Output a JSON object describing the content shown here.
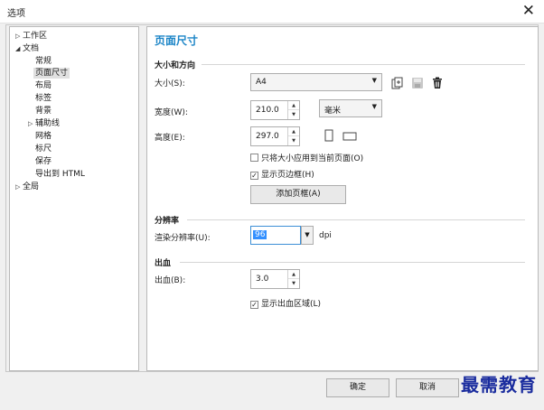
{
  "window": {
    "title": "选项"
  },
  "tree": {
    "items": [
      {
        "label": "工作区",
        "arrow": "▷"
      },
      {
        "label": "文档",
        "arrow": "◢"
      },
      {
        "label": "常规"
      },
      {
        "label": "页面尺寸"
      },
      {
        "label": "布局"
      },
      {
        "label": "标签"
      },
      {
        "label": "背景"
      },
      {
        "label": "辅助线",
        "arrow": "▷"
      },
      {
        "label": "网格"
      },
      {
        "label": "标尺"
      },
      {
        "label": "保存"
      },
      {
        "label": "导出到 HTML"
      },
      {
        "label": "全局",
        "arrow": "▷"
      }
    ]
  },
  "panel": {
    "title": "页面尺寸",
    "size_section": "大小和方向",
    "size_label": "大小(S):",
    "size_value": "A4",
    "width_label": "宽度(W):",
    "width_value": "210.0",
    "unit_value": "毫米",
    "height_label": "高度(E):",
    "height_value": "297.0",
    "apply_current_label": "只将大小应用到当前页面(O)",
    "apply_current_checked": false,
    "show_border_label": "显示页边框(H)",
    "show_border_checked": true,
    "add_frame_label": "添加页框(A)",
    "resolution_section": "分辨率",
    "render_res_label": "渲染分辨率(U):",
    "render_res_value": "96",
    "render_res_unit": "dpi",
    "bleed_section": "出血",
    "bleed_label": "出血(B):",
    "bleed_value": "3.0",
    "show_bleed_label": "显示出血区域(L)",
    "show_bleed_checked": true
  },
  "footer": {
    "ok_label": "确定",
    "cancel_label": "取消"
  },
  "watermark": "最需教育",
  "colors": {
    "accent": "#1c85c7",
    "watermark": "#1a2c9e"
  }
}
